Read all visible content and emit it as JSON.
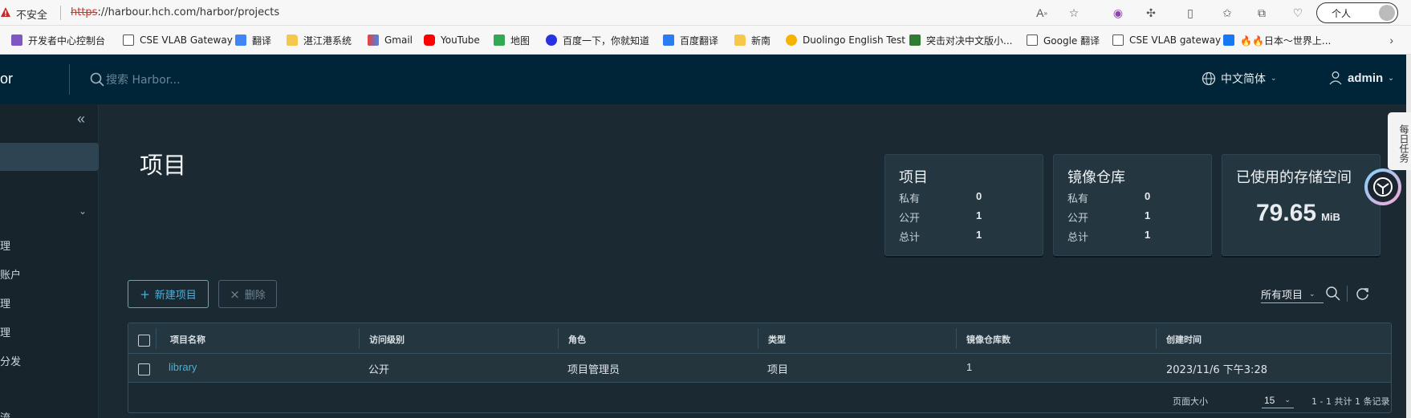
{
  "browser": {
    "security_label": "不安全",
    "url_scheme": "https",
    "url_rest": "://harbour.hch.com/harbor/projects",
    "persona_label": "个人",
    "icons": [
      "read-aloud-icon",
      "favorite-icon",
      "copilot-icon",
      "extensions-icon",
      "split-screen-icon",
      "favorites-icon",
      "collections-icon",
      "browser-essentials-icon"
    ]
  },
  "bookmarks": [
    {
      "label": "开发者中心控制台",
      "icon": "translate-icon"
    },
    {
      "label": "CSE VLAB Gateway",
      "icon": "page-icon"
    },
    {
      "label": "翻译",
      "icon": "translate-icon"
    },
    {
      "label": "湛江港系统",
      "icon": "folder-icon"
    },
    {
      "label": "Gmail",
      "icon": "gmail-icon"
    },
    {
      "label": "YouTube",
      "icon": "youtube-icon"
    },
    {
      "label": "地图",
      "icon": "maps-icon"
    },
    {
      "label": "百度一下，你就知道",
      "icon": "baidu-icon"
    },
    {
      "label": "百度翻译",
      "icon": "baidu-translate-icon"
    },
    {
      "label": "新南",
      "icon": "folder-icon"
    },
    {
      "label": "Duolingo English Test",
      "icon": "duolingo-icon"
    },
    {
      "label": "突击对决中文版小...",
      "icon": "game-icon"
    },
    {
      "label": "Google 翻译",
      "icon": "page-icon"
    },
    {
      "label": "CSE VLAB gateway",
      "icon": "page-icon"
    },
    {
      "label": "🔥🔥日本～世界上...",
      "icon": "facebook-icon"
    }
  ],
  "header": {
    "brand": "or",
    "search_placeholder": "搜索 Harbor...",
    "language": "中文简体",
    "user": "admin"
  },
  "sidebar": {
    "items": [
      "理",
      "账户",
      "理",
      "理",
      "分发",
      "流"
    ]
  },
  "main": {
    "title": "项目",
    "cards": {
      "projects": {
        "title": "项目",
        "rows": [
          {
            "label": "私有",
            "value": "0"
          },
          {
            "label": "公开",
            "value": "1"
          },
          {
            "label": "总计",
            "value": "1"
          }
        ]
      },
      "repos": {
        "title": "镜像仓库",
        "rows": [
          {
            "label": "私有",
            "value": "0"
          },
          {
            "label": "公开",
            "value": "1"
          },
          {
            "label": "总计",
            "value": "1"
          }
        ]
      },
      "storage": {
        "title": "已使用的存储空间",
        "value": "79.65",
        "unit": "MiB"
      }
    },
    "buttons": {
      "new_project": "新建项目",
      "delete": "删除"
    },
    "filter": "所有项目"
  },
  "table": {
    "headers": [
      "项目名称",
      "访问级别",
      "角色",
      "类型",
      "镜像仓库数",
      "创建时间"
    ],
    "rows": [
      {
        "name": "library",
        "access": "公开",
        "role": "项目管理员",
        "type": "项目",
        "repo_count": "1",
        "created": "2023/11/6 下午3:28"
      }
    ],
    "footer": {
      "page_size_label": "页面大小",
      "page_size": "15",
      "records": "1 - 1 共计 1 条记录"
    }
  },
  "floating": {
    "side_tab": "每日任务"
  }
}
